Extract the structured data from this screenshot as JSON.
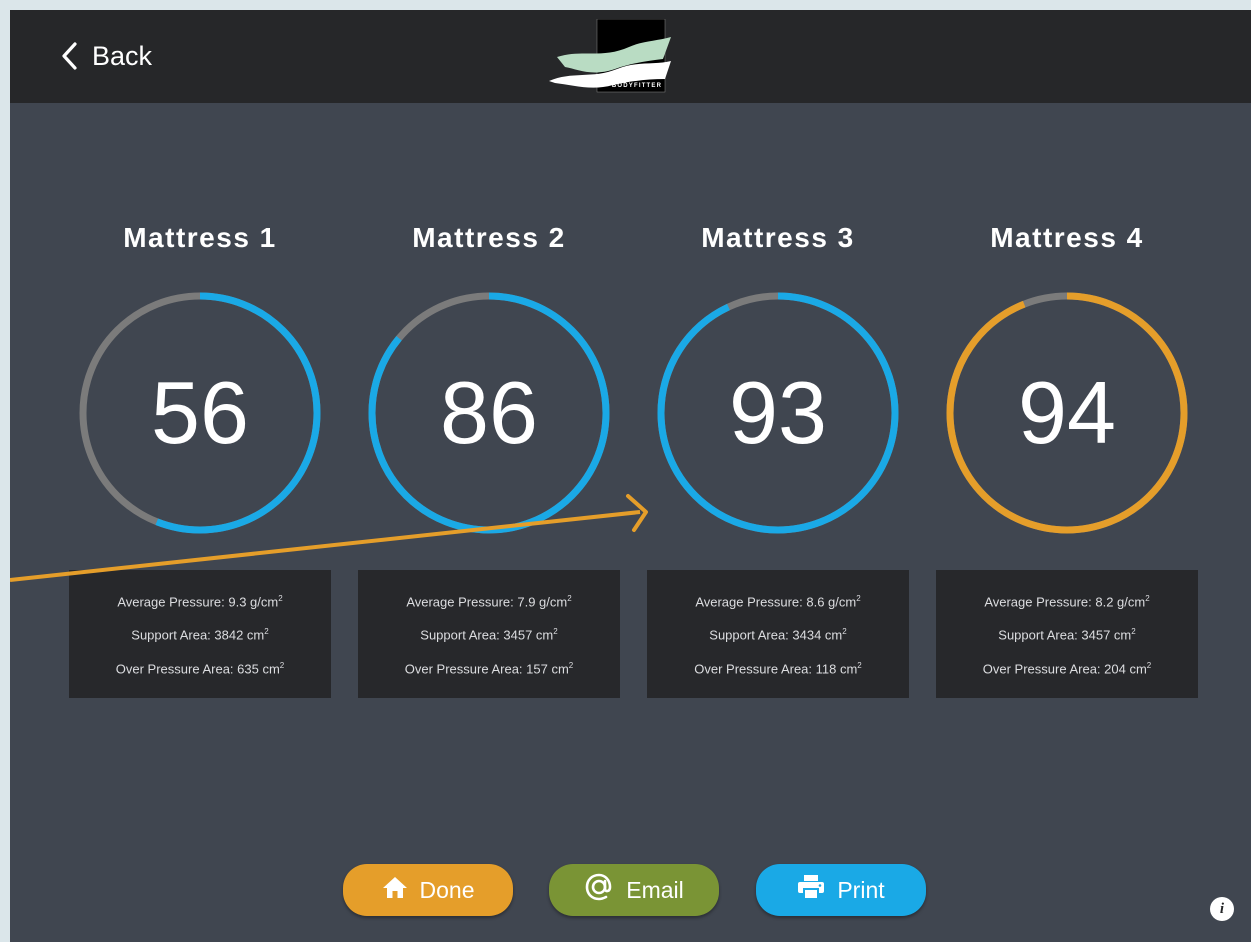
{
  "header": {
    "back_label": "Back",
    "back_icon": "chevron-left-icon",
    "logo_text": "BODYFITTER"
  },
  "colors": {
    "blue": "#1aa9e6",
    "orange": "#e59e2a",
    "gray": "#7b7b7b",
    "green": "#7a9435",
    "dark": "#262729",
    "panel": "#404650"
  },
  "mattresses": [
    {
      "title": "Mattress 1",
      "score": "56",
      "score_fraction": 0.56,
      "ring_color": "#1aa9e6",
      "avg_pressure_label": "Average Pressure: 9.3 g/cm",
      "support_area_label": "Support Area: 3842 cm",
      "over_pressure_label": "Over Pressure Area: 635 cm"
    },
    {
      "title": "Mattress 2",
      "score": "86",
      "score_fraction": 0.86,
      "ring_color": "#1aa9e6",
      "avg_pressure_label": "Average Pressure: 7.9 g/cm",
      "support_area_label": "Support Area: 3457 cm",
      "over_pressure_label": "Over Pressure Area: 157 cm"
    },
    {
      "title": "Mattress 3",
      "score": "93",
      "score_fraction": 0.93,
      "ring_color": "#1aa9e6",
      "avg_pressure_label": "Average Pressure: 8.6 g/cm",
      "support_area_label": "Support Area: 3434 cm",
      "over_pressure_label": "Over Pressure Area: 118 cm"
    },
    {
      "title": "Mattress 4",
      "score": "94",
      "score_fraction": 0.94,
      "ring_color": "#e59e2a",
      "avg_pressure_label": "Average Pressure: 8.2 g/cm",
      "support_area_label": "Support Area: 3457 cm",
      "over_pressure_label": "Over Pressure Area: 204 cm"
    }
  ],
  "superscript": "2",
  "buttons": {
    "done_label": "Done",
    "done_icon": "home-icon",
    "email_label": "Email",
    "email_icon": "at-sign-icon",
    "print_label": "Print",
    "print_icon": "printer-icon"
  },
  "info_icon": "info-icon",
  "info_label": "i"
}
